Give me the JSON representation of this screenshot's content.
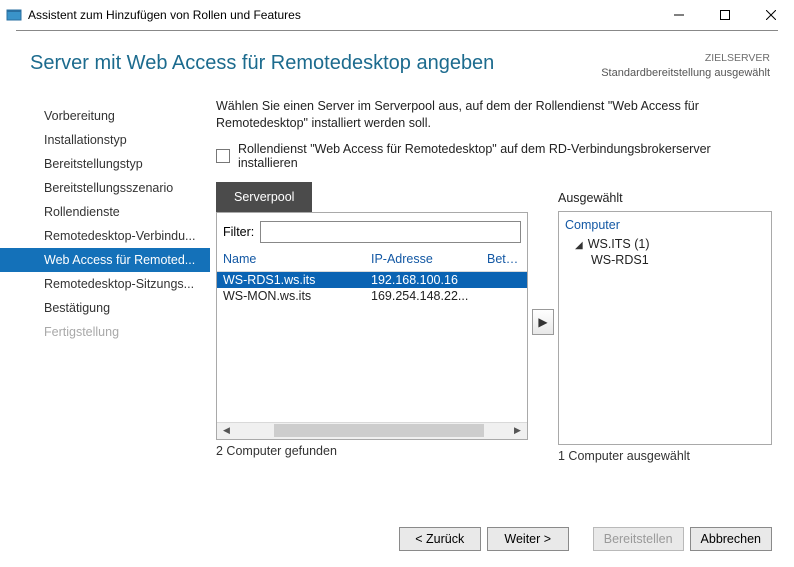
{
  "window": {
    "title": "Assistent zum Hinzufügen von Rollen und Features"
  },
  "header": {
    "title": "Server mit Web Access für Remotedesktop angeben",
    "target_label": "ZIELSERVER",
    "target_value": "Standardbereitstellung ausgewählt"
  },
  "steps": [
    "Vorbereitung",
    "Installationstyp",
    "Bereitstellungstyp",
    "Bereitstellungsszenario",
    "Rollendienste",
    "Remotedesktop-Verbindu...",
    "Web Access für Remoted...",
    "Remotedesktop-Sitzungs...",
    "Bestätigung",
    "Fertigstellung"
  ],
  "main": {
    "instruction": "Wählen Sie einen Server im Serverpool aus, auf dem der Rollendienst \"Web Access für Remotedesktop\" installiert werden soll.",
    "checkbox_label": "Rollendienst \"Web Access für Remotedesktop\" auf dem RD-Verbindungsbrokerserver installieren",
    "pool_tab": "Serverpool",
    "filter_label": "Filter:",
    "filter_value": "",
    "columns": {
      "name": "Name",
      "ip": "IP-Adresse",
      "os": "Betriebssy"
    },
    "rows": [
      {
        "name": "WS-RDS1.ws.its",
        "ip": "192.168.100.16",
        "selected": true
      },
      {
        "name": "WS-MON.ws.its",
        "ip": "169.254.148.22...",
        "selected": false
      }
    ],
    "found_count": "2 Computer gefunden",
    "selected_header": "Ausgewählt",
    "selected_col": "Computer",
    "selected_group": "WS.ITS (1)",
    "selected_items": [
      "WS-RDS1"
    ],
    "selected_count": "1 Computer ausgewählt"
  },
  "buttons": {
    "back": "< Zurück",
    "next": "Weiter >",
    "deploy": "Bereitstellen",
    "cancel": "Abbrechen"
  }
}
